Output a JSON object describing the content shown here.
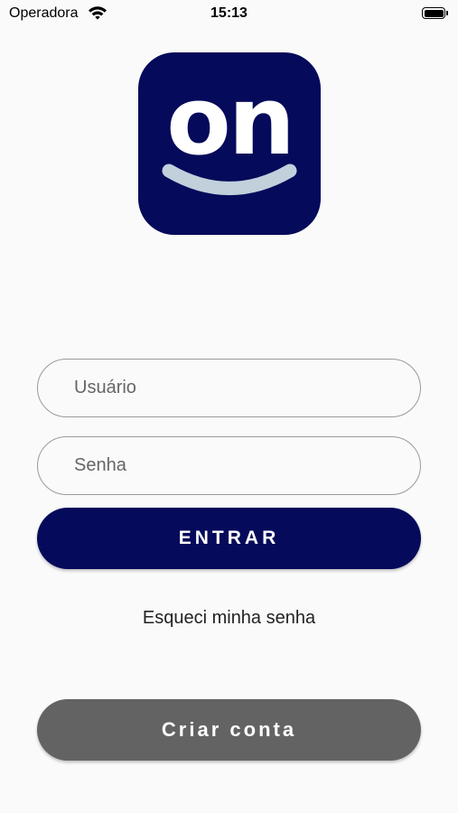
{
  "status_bar": {
    "carrier": "Operadora",
    "time": "15:13"
  },
  "logo": {
    "text": "on",
    "background": "#050a5a",
    "smile_color": "#c2d0dc"
  },
  "login": {
    "username_placeholder": "Usuário",
    "password_placeholder": "Senha",
    "submit_label": "ENTRAR",
    "forgot_label": "Esqueci minha senha",
    "create_account_label": "Criar conta"
  },
  "colors": {
    "primary": "#050a5a",
    "secondary": "#636363",
    "background": "#fafafa"
  }
}
